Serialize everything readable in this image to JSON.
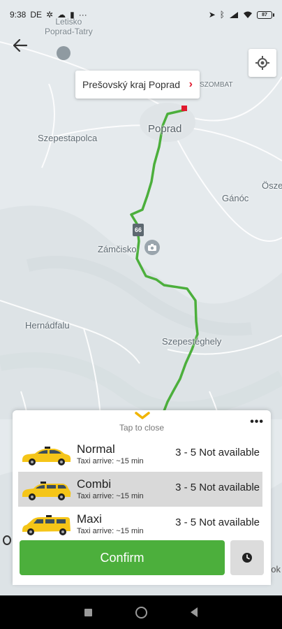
{
  "status_bar": {
    "time": "9:38",
    "carrier_badge": "DE",
    "battery": "87"
  },
  "map": {
    "airport_label": "Letisko\nPoprad-Tatry",
    "places": {
      "szombat": "SZOMBAT",
      "poprad": "Poprad",
      "szepestapolca": "Szepestapolca",
      "osze": "Ösze",
      "ganoc": "Gánóc",
      "zamcisko": "Zámčisko",
      "hernadfalu": "Hernádfalu",
      "szepesteghely": "Szepestéghely"
    },
    "road_number": "66",
    "destination_callout": "Prešovský kraj Poprad",
    "route_color": "#4caf3c",
    "marker_color": "#e0192e"
  },
  "sheet": {
    "tap_to_close": "Tap to close",
    "options": [
      {
        "name": "Normal",
        "eta": "Taxi arrive: ~15 min",
        "price": "3 - 5 Not available",
        "selected": false,
        "icon": "taxi-sedan"
      },
      {
        "name": "Combi",
        "eta": "Taxi arrive: ~15 min",
        "price": "3 - 5 Not available",
        "selected": true,
        "icon": "taxi-wagon"
      },
      {
        "name": "Maxi",
        "eta": "Taxi arrive: ~15 min",
        "price": "3 - 5 Not available",
        "selected": false,
        "icon": "taxi-van"
      }
    ],
    "confirm_label": "Confirm",
    "accent": "#4caf3c",
    "handle_color": "#f0b400"
  },
  "side_peek_right": "ok"
}
